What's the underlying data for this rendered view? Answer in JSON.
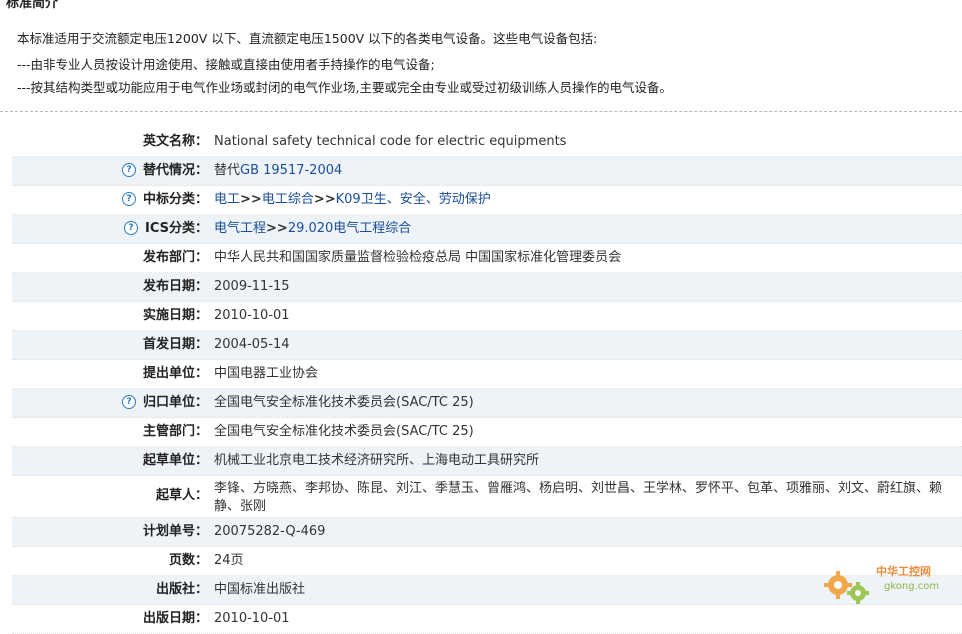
{
  "intro": {
    "title": "标准简介",
    "lines": [
      "本标准适用于交流额定电压1200V 以下、直流额定电压1500V 以下的各类电气设备。这些电气设备包括:",
      "---由非专业人员按设计用途使用、接触或直接由使用者手持操作的电气设备;",
      "---按其结构类型或功能应用于电气作业场或封闭的电气作业场,主要或完全由专业或受过初级训练人员操作的电气设备。"
    ]
  },
  "fields": {
    "english_name": {
      "label": "英文名称：",
      "value": "National safety technical code for electric equipments"
    },
    "replaces": {
      "label": "替代情况：",
      "prefix": "替代",
      "link": "GB 19517-2004"
    },
    "ccs": {
      "label": "中标分类：",
      "links": [
        "电工",
        "电工综合",
        "K09卫生、安全、劳动保护"
      ],
      "separator": ">>"
    },
    "ics": {
      "label": "ICS分类：",
      "links": [
        "电气工程",
        "29.020电气工程综合"
      ],
      "separator": ">>"
    },
    "publisher_dept": {
      "label": "发布部门：",
      "value": "中华人民共和国国家质量监督检验检疫总局 中国国家标准化管理委员会"
    },
    "release_date": {
      "label": "发布日期：",
      "value": "2009-11-15"
    },
    "impl_date": {
      "label": "实施日期：",
      "value": "2010-10-01"
    },
    "first_date": {
      "label": "首发日期：",
      "value": "2004-05-14"
    },
    "proposer": {
      "label": "提出单位：",
      "value": "中国电器工业协会"
    },
    "centralized": {
      "label": "归口单位：",
      "value": "全国电气安全标准化技术委员会(SAC/TC 25)"
    },
    "authority": {
      "label": "主管部门：",
      "value": "全国电气安全标准化技术委员会(SAC/TC 25)"
    },
    "drafting_unit": {
      "label": "起草单位：",
      "value": "机械工业北京电工技术经济研究所、上海电动工具研究所"
    },
    "drafters": {
      "label": "起草人：",
      "value": "李锋、方晓燕、李邦协、陈昆、刘江、季慧玉、曾雁鸿、杨启明、刘世昌、王学林、罗怀平、包革、项雅丽、刘文、蔚红旗、赖静、张刚"
    },
    "plan_no": {
      "label": "计划单号：",
      "value": "20075282-Q-469"
    },
    "pages": {
      "label": "页数：",
      "value": "24页"
    },
    "press": {
      "label": "出版社：",
      "value": "中国标准出版社"
    },
    "pub_date": {
      "label": "出版日期：",
      "value": "2010-10-01"
    }
  },
  "help_icon": "?",
  "watermark": {
    "name": "中华工控网",
    "domain": "gkong.com"
  },
  "colors": {
    "link": "#1a4e9a",
    "shaded_row": "#eef3f7",
    "help_icon": "#2b7bc4"
  }
}
